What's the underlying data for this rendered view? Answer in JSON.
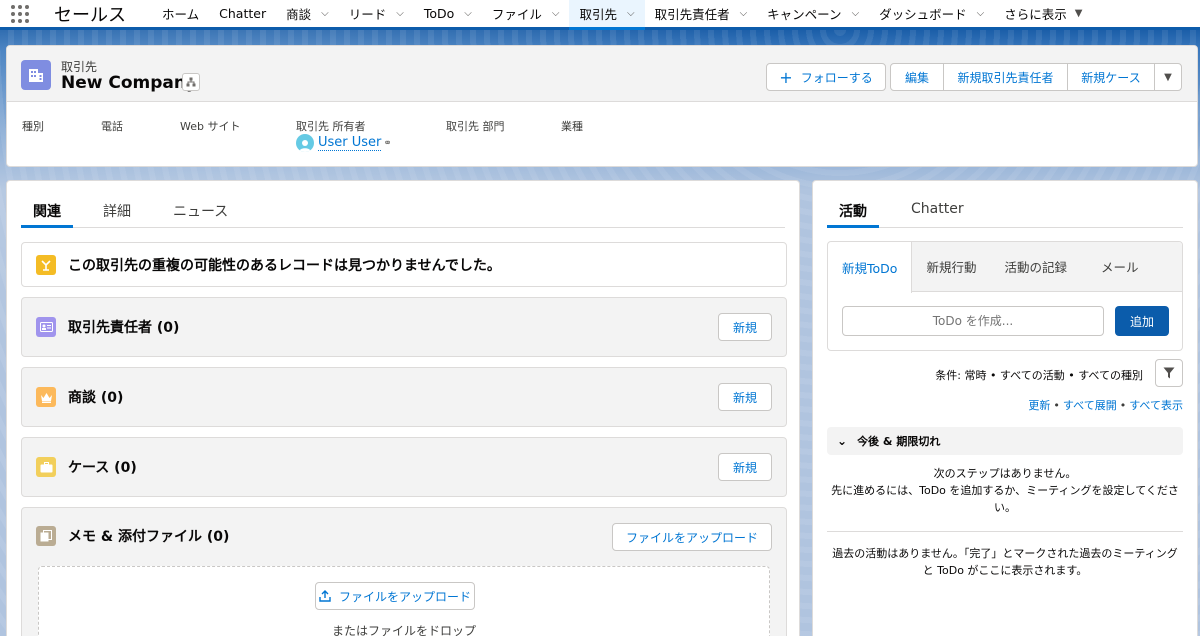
{
  "nav": {
    "app_name": "セールス",
    "items": [
      {
        "label": "ホーム"
      },
      {
        "label": "Chatter"
      },
      {
        "label": "商談"
      },
      {
        "label": "リード"
      },
      {
        "label": "ToDo"
      },
      {
        "label": "ファイル"
      },
      {
        "label": "取引先"
      },
      {
        "label": "取引先責任者"
      },
      {
        "label": "キャンペーン"
      },
      {
        "label": "ダッシュボード"
      },
      {
        "label": "さらに表示"
      }
    ]
  },
  "record": {
    "object_label": "取引先",
    "name": "New Company",
    "actions": {
      "follow": "フォローする",
      "edit": "編集",
      "new_contact": "新規取引先責任者",
      "new_case": "新規ケース"
    },
    "fields": {
      "type": "種別",
      "phone": "電話",
      "website": "Web サイト",
      "owner": "取引先 所有者",
      "division": "取引先 部門",
      "industry": "業種"
    },
    "owner_name": "User User"
  },
  "left": {
    "tabs": {
      "related": "関連",
      "details": "詳細",
      "news": "ニュース"
    },
    "duplicate_message": "この取引先の重複の可能性のあるレコードは見つかりませんでした。",
    "related_lists": {
      "contacts": "取引先責任者 (0)",
      "opportunities": "商談 (0)",
      "cases": "ケース (0)",
      "files": "メモ & 添付ファイル (0)"
    },
    "new_label": "新規",
    "upload_files_label": "ファイルをアップロード",
    "drop_text": "またはファイルをドロップ"
  },
  "right": {
    "tabs": {
      "activity": "活動",
      "chatter": "Chatter"
    },
    "composer_tabs": {
      "new_todo": "新規ToDo",
      "new_event": "新規行動",
      "log_activity": "活動の記録",
      "email": "メール"
    },
    "todo_placeholder": "ToDo を作成...",
    "add_label": "追加",
    "filter_text": "条件: 常時 • すべての活動 • すべての種別",
    "links": {
      "refresh": "更新",
      "expand_all": "すべて展開",
      "view_all": "すべて表示"
    },
    "upcoming_title": "今後 & 期限切れ",
    "next_steps_line1": "次のステップはありません。",
    "next_steps_line2": "先に進めるには、ToDo を追加するか、ミーティングを設定してください。",
    "past_activities": "過去の活動はありません。「完了」とマークされた過去のミーティングと ToDo がここに表示されます。"
  },
  "colors": {
    "brand": "#0176d3",
    "account_icon": "#7f8de1",
    "contacts_icon": "#a094ed",
    "opportunities_icon": "#fcb95b",
    "cases_icon": "#f2cf5b",
    "files_icon": "#baac93",
    "duplicate_icon": "#f4bc25"
  }
}
